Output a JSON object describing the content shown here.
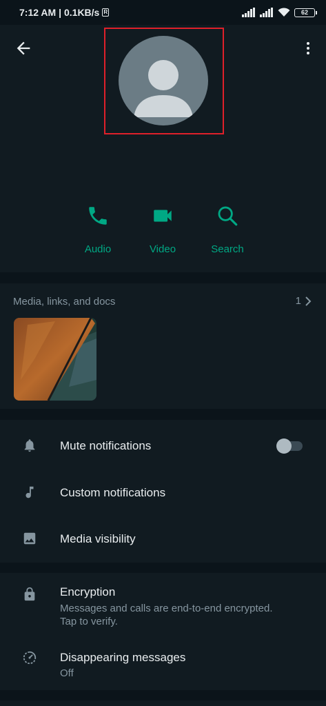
{
  "status_bar": {
    "time": "7:12 AM",
    "speed": "| 0.1KB/s",
    "badge": "R",
    "battery": "62"
  },
  "header": {
    "back_icon": "arrow-left-icon",
    "menu_icon": "more-vert-icon",
    "avatar_icon": "default-person-avatar"
  },
  "actions": [
    {
      "label": "Audio",
      "icon": "phone-icon"
    },
    {
      "label": "Video",
      "icon": "videocam-icon"
    },
    {
      "label": "Search",
      "icon": "search-icon"
    }
  ],
  "media": {
    "title": "Media, links, and docs",
    "count": "1"
  },
  "settings": {
    "mute_label": "Mute notifications",
    "mute_on": false,
    "custom_label": "Custom notifications",
    "visibility_label": "Media visibility"
  },
  "privacy": {
    "encryption_title": "Encryption",
    "encryption_line1": "Messages and calls are end-to-end encrypted.",
    "encryption_line2": "Tap to verify.",
    "disappearing_title": "Disappearing messages",
    "disappearing_value": "Off"
  },
  "colors": {
    "accent": "#00a884",
    "background": "#0b141a",
    "surface": "#111b21",
    "highlight_box": "#e0202a"
  }
}
